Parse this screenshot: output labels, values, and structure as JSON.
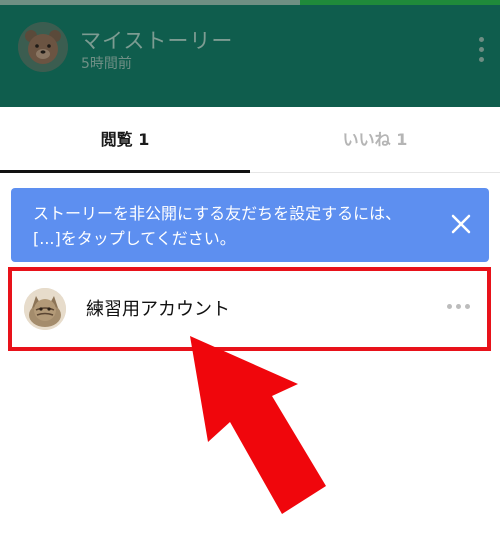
{
  "story": {
    "progress": 0.6,
    "title": "マイストーリー",
    "time_ago": "5時間前",
    "menu_icon": "kebab-menu-icon",
    "avatar_icon": "bear-avatar-icon"
  },
  "tabs": [
    {
      "label": "閲覧 1",
      "active": true
    },
    {
      "label": "いいね 1",
      "active": false
    }
  ],
  "banner": {
    "text": "ストーリーを非公開にする友だちを設定するには、[...]をタップしてください。",
    "close_icon": "close-icon",
    "color": "#5d8ff0"
  },
  "viewers": [
    {
      "name": "練習用アカウント",
      "avatar_icon": "cat-avatar-icon",
      "more_icon": "more-horizontal-icon"
    }
  ],
  "annotation": {
    "highlight_color": "#e8121a",
    "arrow_icon": "red-arrow-annotation"
  }
}
